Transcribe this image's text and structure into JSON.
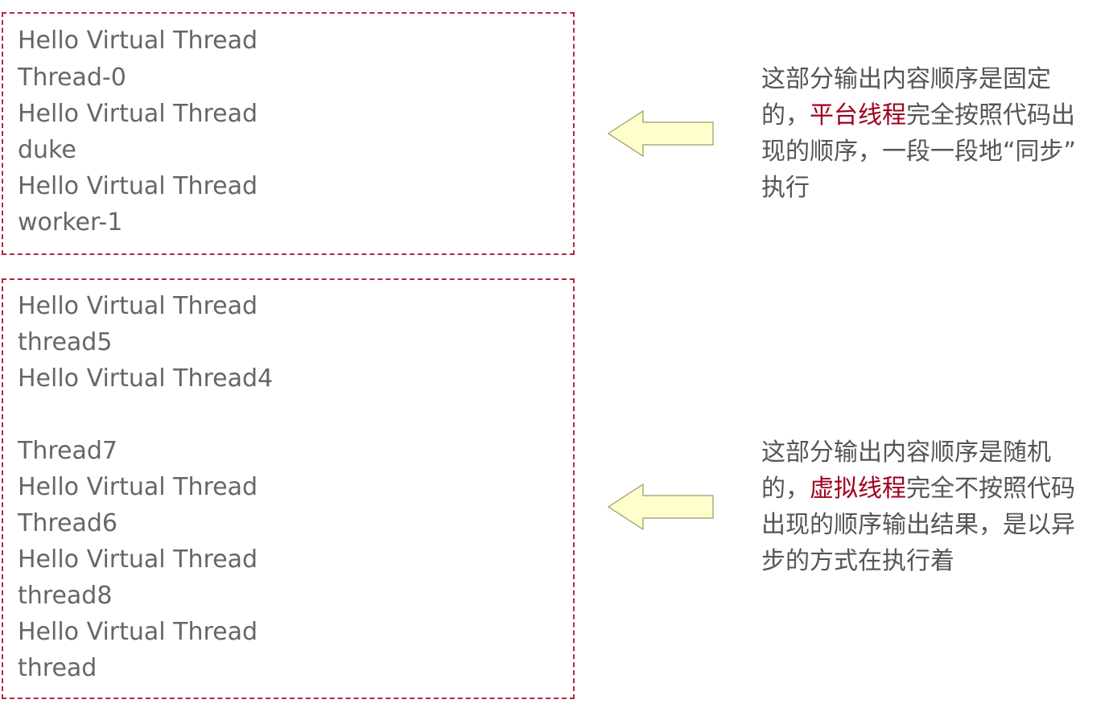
{
  "top_box": {
    "lines": [
      "Hello Virtual Thread",
      "Thread-0",
      "Hello Virtual Thread",
      "duke",
      "Hello Virtual Thread",
      "worker-1"
    ]
  },
  "bottom_box": {
    "lines": [
      "Hello Virtual Thread",
      "thread5",
      "Hello Virtual Thread4",
      "",
      "Thread7",
      "Hello Virtual Thread",
      "Thread6",
      "Hello Virtual Thread",
      "thread8",
      "Hello Virtual Thread",
      "thread"
    ]
  },
  "notes": {
    "top": {
      "line1": "这部分输出内容顺序是固定",
      "line2_pre": "的，",
      "line2_highlight": "平台线程",
      "line2_post": "完全按照代码出",
      "line3": "现的顺序，一段一段地“同步”",
      "line4": "执行"
    },
    "bottom": {
      "line1": "这部分输出内容顺序是随机",
      "line2_pre": "的，",
      "line2_highlight": "虚拟线程",
      "line2_post": "完全不按照代码",
      "line3": "出现的顺序输出结果，是以异",
      "line4": "步的方式在执行着"
    }
  },
  "colors": {
    "box_border": "#b0283c",
    "text": "#666666",
    "highlight": "#a0001e",
    "arrow_fill": "#ffffcc",
    "arrow_stroke": "#999966"
  },
  "icons": {
    "arrow_top": "left-arrow-icon",
    "arrow_bottom": "left-arrow-icon"
  }
}
